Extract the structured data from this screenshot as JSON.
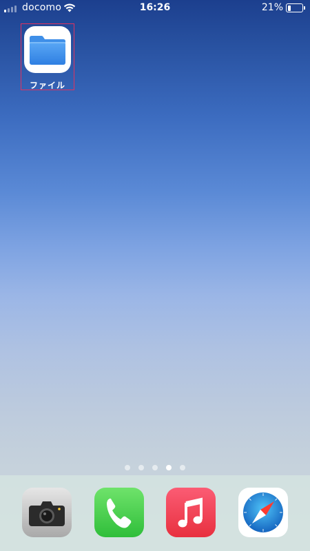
{
  "status_bar": {
    "carrier": "docomo",
    "time": "16:26",
    "battery_percent": "21%",
    "battery_level": 0.21,
    "signal_bars_active": 1,
    "signal_bars_total": 4
  },
  "home_screen": {
    "apps": [
      {
        "label": "ファイル",
        "icon": "files-folder-icon",
        "highlighted": true,
        "highlight_color": "#e0325f"
      }
    ],
    "page_indicator": {
      "total": 5,
      "active_index": 3
    }
  },
  "dock": {
    "apps": [
      {
        "icon": "camera-icon"
      },
      {
        "icon": "phone-icon",
        "color": "#4cd964"
      },
      {
        "icon": "music-icon",
        "color": "#f2445a"
      },
      {
        "icon": "safari-icon",
        "color": "#1e88e5"
      }
    ]
  }
}
